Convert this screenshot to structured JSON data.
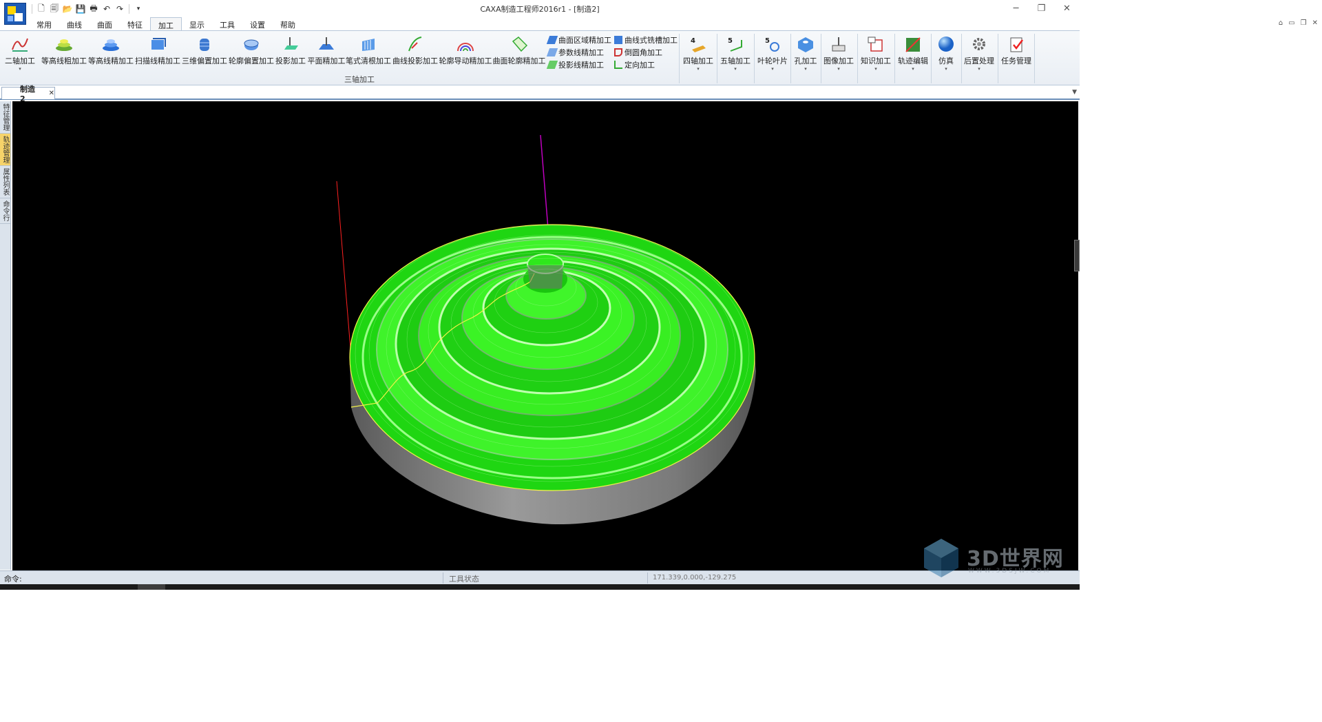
{
  "window": {
    "title": "CAXA制造工程师2016r1 - [制造2]"
  },
  "quick_access": [
    "new-icon",
    "open-doc-icon",
    "folder-icon",
    "save-icon",
    "print-icon",
    "undo-icon",
    "redo-icon",
    "customize-icon"
  ],
  "ribbon_tabs": [
    "常用",
    "曲线",
    "曲面",
    "特征",
    "加工",
    "显示",
    "工具",
    "设置",
    "帮助"
  ],
  "active_tab": "加工",
  "ribbon": {
    "buttons": {
      "b0": "二轴加工",
      "b1": "等高线粗加工",
      "b2": "等高线精加工",
      "b3": "扫描线精加工",
      "b4": "三维偏置加工",
      "b5": "轮廓偏置加工",
      "b6": "投影加工",
      "b7": "平面精加工",
      "b8": "笔式清根加工",
      "b9": "曲线投影加工",
      "b10": "轮廓导动精加工",
      "b11": "曲面轮廓精加工"
    },
    "small_buttons": {
      "s0": "曲面区域精加工",
      "s1": "参数线精加工",
      "s2": "投影线精加工",
      "s3": "曲线式铣槽加工",
      "s4": "倒圆角加工",
      "s5": "定向加工"
    },
    "group_label": "三轴加工",
    "right_buttons": {
      "r0": "四轴加工",
      "r1": "五轴加工",
      "r2": "叶轮叶片",
      "r3": "孔加工",
      "r4": "图像加工",
      "r5": "知识加工",
      "r6": "轨迹编辑",
      "r7": "仿真",
      "r8": "后置处理",
      "r9": "任务管理"
    }
  },
  "document_tab": {
    "label": "制造2"
  },
  "side_tabs": [
    "特征管理",
    "轨迹管理",
    "属性列表",
    "命令行"
  ],
  "active_side_tab": "轨迹管理",
  "statusbar": {
    "command_label": "命令:",
    "tool_state": "工具状态",
    "coordinates": "171.339,0.000,-129.275"
  },
  "watermark": {
    "text": "3D世界网",
    "sub": "WWW.3DSJW.COM"
  },
  "colors": {
    "viewport_bg": "#000000",
    "toolpath": "#22ff00",
    "stock": "#8a8a8a",
    "axis_x": "#ff2020",
    "axis_z": "#c000c0",
    "contour": "#ffff40"
  }
}
